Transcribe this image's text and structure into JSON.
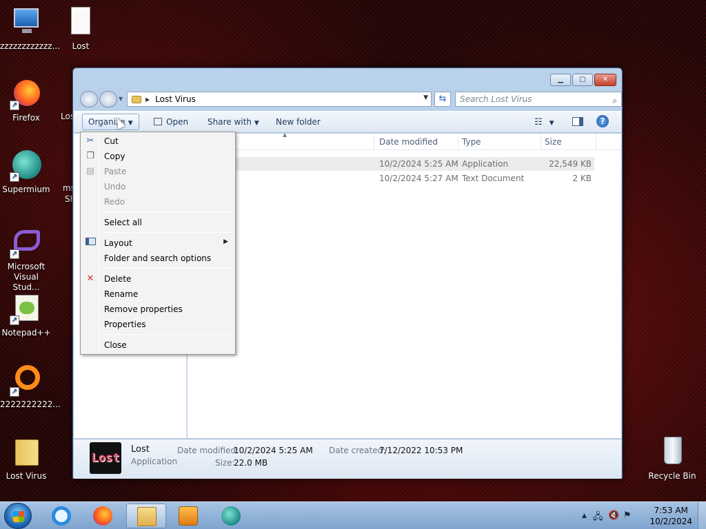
{
  "desktop": {
    "icons": [
      {
        "label": "zzzzzzzzzzzz...",
        "icon": "computer-icon"
      },
      {
        "label": "Lost",
        "icon": "text-file-icon"
      },
      {
        "label": "Firefox",
        "icon": "firefox-icon"
      },
      {
        "label": "Supermium",
        "icon": "supermium-icon"
      },
      {
        "label": "Microsoft Visual Stud...",
        "icon": "visual-studio-icon"
      },
      {
        "label": "Notepad++",
        "icon": "notepadpp-icon"
      },
      {
        "label": "2222222222...",
        "icon": "ring-icon"
      },
      {
        "label": "Lost Virus",
        "icon": "folder-icon"
      },
      {
        "label": "Recycle Bin",
        "icon": "recycle-bin-icon"
      }
    ],
    "partial_labels": {
      "lost": "Los",
      "ms": "ms",
      "sh": "Sh"
    }
  },
  "window": {
    "address": {
      "path": "Lost Virus"
    },
    "search": {
      "placeholder": "Search Lost Virus"
    },
    "toolbar": {
      "organize": "Organize",
      "open": "Open",
      "share_with": "Share with",
      "new_folder": "New folder"
    },
    "columns": [
      "Date modified",
      "Type",
      "Size"
    ],
    "files": [
      {
        "date": "10/2/2024 5:25 AM",
        "type": "Application",
        "size": "22,549 KB",
        "selected": true
      },
      {
        "date": "10/2/2024 5:27 AM",
        "type": "Text Document",
        "size": "2 KB",
        "selected": false
      }
    ],
    "details": {
      "name": "Lost",
      "type": "Application",
      "thumb_text": "Lost",
      "date_modified_label": "Date modified:",
      "date_modified": "10/2/2024 5:25 AM",
      "size_label": "Size:",
      "size": "22.0 MB",
      "date_created_label": "Date created:",
      "date_created": "7/12/2022 10:53 PM"
    }
  },
  "context_menu": {
    "items": [
      {
        "label": "Cut",
        "enabled": true,
        "icon": "scissors-icon"
      },
      {
        "label": "Copy",
        "enabled": true,
        "icon": "copy-icon"
      },
      {
        "label": "Paste",
        "enabled": false,
        "icon": "paste-icon"
      },
      {
        "label": "Undo",
        "enabled": false
      },
      {
        "label": "Redo",
        "enabled": false
      },
      {
        "label": "Select all",
        "enabled": true
      },
      {
        "label": "Layout",
        "enabled": true,
        "icon": "layout-icon",
        "submenu": true
      },
      {
        "label": "Folder and search options",
        "enabled": true
      },
      {
        "label": "Delete",
        "enabled": true,
        "icon": "delete-x-icon"
      },
      {
        "label": "Rename",
        "enabled": true
      },
      {
        "label": "Remove properties",
        "enabled": true
      },
      {
        "label": "Properties",
        "enabled": true
      },
      {
        "label": "Close",
        "enabled": true
      }
    ]
  },
  "taskbar": {
    "apps": [
      "internet-explorer-icon",
      "firefox-icon",
      "explorer-folder-icon",
      "media-player-icon",
      "supermium-icon"
    ],
    "clock": {
      "time": "7:53 AM",
      "date": "10/2/2024"
    }
  },
  "colors": {
    "accent": "#3a6ea5",
    "taskbar": "#8fb0d8",
    "desktop": "#2a0808"
  }
}
